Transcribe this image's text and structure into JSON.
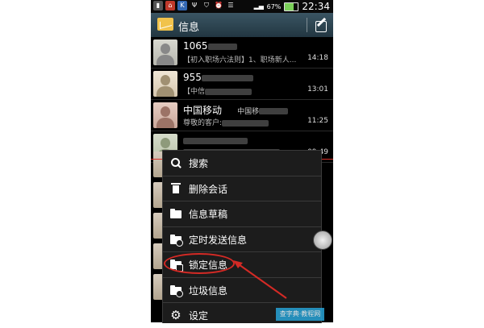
{
  "status_bar": {
    "battery_percent": 67,
    "battery_label": "67%",
    "time": "22:34",
    "left_icons": [
      "signal-icon",
      "home-icon",
      "k-app-icon",
      "usb-icon",
      "shield-icon",
      "alarm-icon",
      "wifi-icon"
    ]
  },
  "action_bar": {
    "title": "信息",
    "compose_icon": "compose-icon"
  },
  "conversations": [
    {
      "sender": "1065",
      "snippet": "【初入职场六法则】1、职场新人...",
      "time": "14:18"
    },
    {
      "sender": "955",
      "snippet": "【中信",
      "time": "13:01"
    },
    {
      "sender": "中国移动",
      "sender_suffix": "中国移",
      "snippet": "尊敬的客户:",
      "time": "11:25"
    },
    {
      "sender": "",
      "snippet": "",
      "time": "09:49"
    }
  ],
  "menu": {
    "items": [
      {
        "label": "搜索",
        "icon": "search-icon"
      },
      {
        "label": "删除会话",
        "icon": "trash-icon"
      },
      {
        "label": "信息草稿",
        "icon": "folder-icon"
      },
      {
        "label": "定时发送信息",
        "icon": "scheduled-folder-icon"
      },
      {
        "label": "锁定信息",
        "icon": "locked-folder-icon"
      },
      {
        "label": "垃圾信息",
        "icon": "spam-folder-icon"
      },
      {
        "label": "设定",
        "icon": "gear-icon"
      }
    ]
  },
  "colors": {
    "annotation_red": "#d42a25",
    "action_bar": "#2c4450",
    "battery_green": "#7bd05a"
  }
}
